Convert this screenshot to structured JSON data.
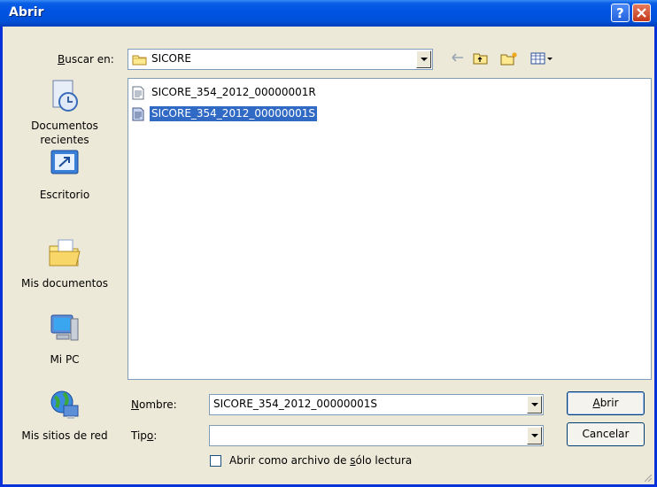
{
  "window": {
    "title": "Abrir"
  },
  "look_in": {
    "label_u": "B",
    "label_rest": "uscar en:",
    "value": "SICORE"
  },
  "places": [
    {
      "label": "Documentos recientes"
    },
    {
      "label": "Escritorio"
    },
    {
      "label": "Mis documentos"
    },
    {
      "label": "Mi PC"
    },
    {
      "label": "Mis sitios de red"
    }
  ],
  "files": [
    {
      "name": "SICORE_354_2012_00000001R",
      "selected": false
    },
    {
      "name": "SICORE_354_2012_00000001S",
      "selected": true
    }
  ],
  "filename": {
    "label_u": "N",
    "label_rest": "ombre:",
    "value": "SICORE_354_2012_00000001S"
  },
  "filetype": {
    "label_pre": "Tip",
    "label_u": "o",
    "label_rest": ":",
    "value": ""
  },
  "readonly": {
    "label_pre": "Abrir como archivo de ",
    "label_u": "s",
    "label_rest": "ólo lectura",
    "checked": false
  },
  "buttons": {
    "open_u": "A",
    "open_rest": "brir",
    "cancel": "Cancelar"
  }
}
